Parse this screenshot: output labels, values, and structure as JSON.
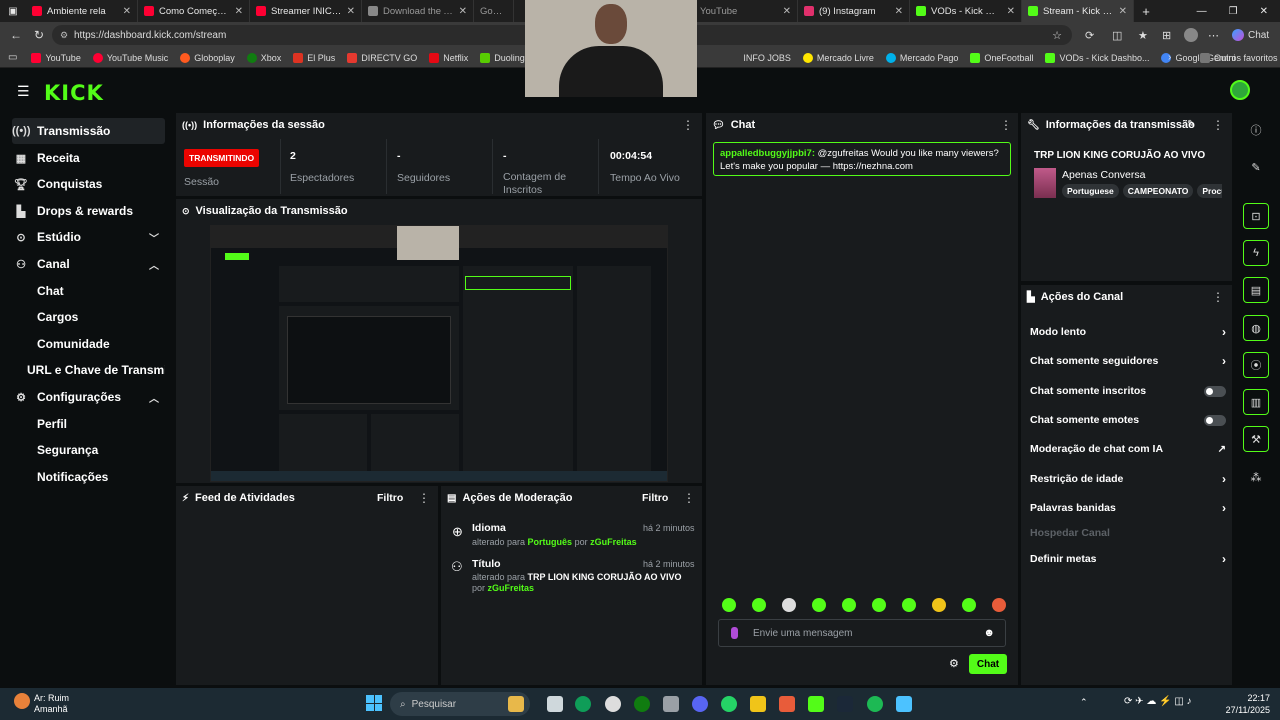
{
  "browser": {
    "tabs": [
      {
        "title": "Ambiente rela",
        "color": "#ff0033"
      },
      {
        "title": "Como Começar a F",
        "color": "#ff0033"
      },
      {
        "title": "Streamer INICIANT",
        "color": "#ff0033"
      },
      {
        "title": "Download the Aith",
        "color": "#888888"
      },
      {
        "title": "Google C",
        "color": "#888888"
      },
      {
        "title": "YouTube",
        "color": "#ff0033"
      },
      {
        "title": "(9) Instagram",
        "color": "#e1306c"
      },
      {
        "title": "VODs - Kick Dashb",
        "color": "#53fc18"
      },
      {
        "title": "Stream - Kick Dashb",
        "color": "#53fc18"
      }
    ],
    "url": "https://dashboard.kick.com/stream",
    "chat_label": "Chat",
    "bookmarks": [
      "YouTube",
      "YouTube Music",
      "Globoplay",
      "Xbox",
      "El Plus",
      "DIRECTV GO",
      "Netflix",
      "Duolingo",
      "Wi",
      "INFO JOBS",
      "Mercado Livre",
      "Mercado Pago",
      "OneFootball",
      "VODs - Kick Dashbo...",
      "Google Gemini"
    ],
    "other_favorites": "Outros favoritos"
  },
  "logo": "KICK",
  "sidebar": {
    "items": [
      {
        "label": "Transmissão",
        "icon": "broadcast-icon"
      },
      {
        "label": "Receita",
        "icon": "revenue-icon"
      },
      {
        "label": "Conquistas",
        "icon": "trophy-icon"
      },
      {
        "label": "Drops & rewards",
        "icon": "drops-icon"
      },
      {
        "label": "Estúdio",
        "icon": "studio-icon"
      },
      {
        "label": "Canal",
        "icon": "channel-icon"
      },
      {
        "label": "Chat"
      },
      {
        "label": "Cargos"
      },
      {
        "label": "Comunidade"
      },
      {
        "label": "URL e Chave de Transmissã"
      },
      {
        "label": "Configurações",
        "icon": "settings-icon"
      },
      {
        "label": "Perfil"
      },
      {
        "label": "Segurança"
      },
      {
        "label": "Notificações"
      }
    ]
  },
  "session": {
    "title": "Informações da sessão",
    "badge": "TRANSMITINDO",
    "session_label": "Sessão",
    "viewers_value": "2",
    "viewers_label": "Espectadores",
    "followers_value": "-",
    "followers_label": "Seguidores",
    "subs_value": "-",
    "subs_label": "Contagem de Inscritos",
    "time_value": "00:04:54",
    "time_label": "Tempo Ao Vivo"
  },
  "preview": {
    "title": "Visualização da Transmissão"
  },
  "activity": {
    "title": "Feed de Atividades",
    "filter": "Filtro"
  },
  "moderation": {
    "title": "Ações de Moderação",
    "filter": "Filtro",
    "entries": [
      {
        "heading": "Idioma",
        "time": "há 2 minutos",
        "prefix": "alterado para ",
        "value": "Português",
        "by": " por ",
        "user": "zGuFreitas"
      },
      {
        "heading": "Título",
        "time": "há 2 minutos",
        "prefix": "alterado para ",
        "value": "TRP LION KING CORUJÃO AO VIVO",
        "by": " por ",
        "user": "zGuFreitas"
      }
    ]
  },
  "chat": {
    "title": "Chat",
    "message": {
      "user": "appalledbuggyjjpbi7:",
      "text": " @zgufreitas Would you like many viewers? Let's make you popular — https://nezhna.com"
    },
    "placeholder": "Envie uma mensagem",
    "send": "Chat"
  },
  "stream_info": {
    "title": "Informações da transmissão",
    "stream_title": "TRP LION KING CORUJÃO AO VIVO",
    "category": "Apenas Conversa",
    "tags": [
      "Portuguese",
      "CAMPEONATO",
      "Procu"
    ]
  },
  "channel_actions": {
    "title": "Ações do Canal",
    "items": [
      {
        "label": "Modo lento",
        "control": "arrow"
      },
      {
        "label": "Chat somente seguidores",
        "control": "arrow"
      },
      {
        "label": "Chat somente inscritos",
        "control": "toggle"
      },
      {
        "label": "Chat somente emotes",
        "control": "toggle"
      },
      {
        "label": "Moderação de chat com IA",
        "control": "external"
      },
      {
        "label": "Restrição de idade",
        "control": "arrow"
      },
      {
        "label": "Palavras banidas",
        "control": "arrow"
      },
      {
        "label": "Hospedar Canal",
        "control": "disabled"
      },
      {
        "label": "Definir metas",
        "control": "arrow"
      }
    ]
  },
  "taskbar": {
    "weather_line1": "Ar: Ruim",
    "weather_line2": "Amanhã",
    "search": "Pesquisar",
    "time": "22:17",
    "date": "27/11/2025"
  },
  "colors": {
    "accent": "#53fc18",
    "live": "#eb0400",
    "panel": "#181b1d"
  }
}
